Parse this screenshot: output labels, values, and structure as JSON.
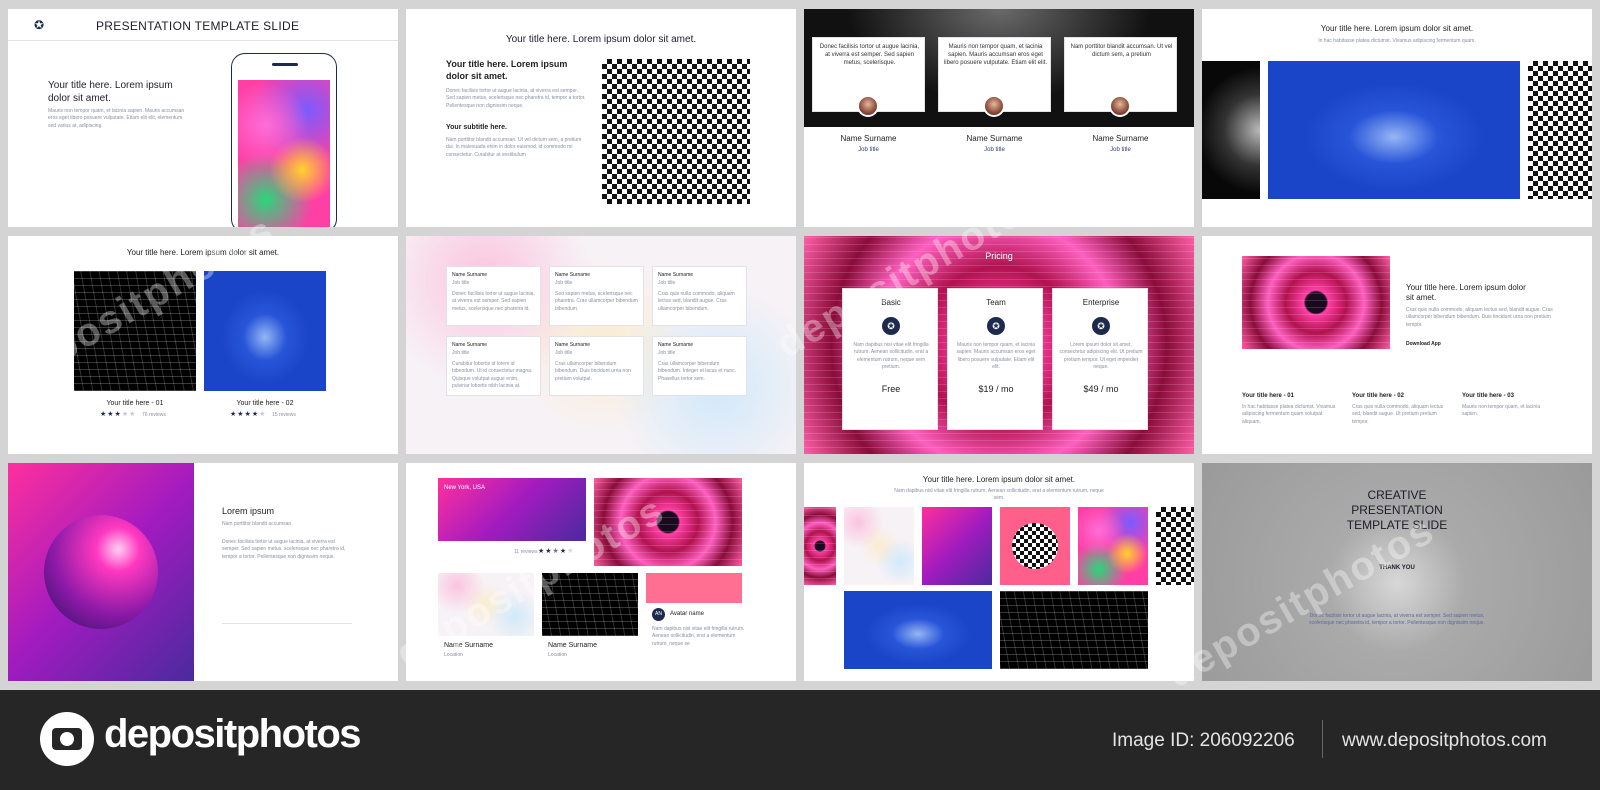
{
  "slides": {
    "s1": {
      "header": "PRESENTATION TEMPLATE SLIDE",
      "title": "Your title here. Lorem ipsum dolor sit amet.",
      "body": "Mauris non tempor quam, et lacinia sapien. Mauris accumsan eros eget libero posuere vulputate. Etiam elit elit, elementum sed varius at, adipiscing."
    },
    "s2": {
      "top_title": "Your title here. Lorem ipsum dolor sit amet.",
      "title": "Your title here. Lorem ipsum dolor sit amet.",
      "body": "Donec facilisis tortor ut augue lacinia, at viverra est semper. Sed sapien metus, scelerisque nec pharetra id, tempor a tortor. Pellentesque non dignissim neque.",
      "subtitle": "Your subtitle here.",
      "body2": "Nam porttitor blandit accumsan. Ut vel dictum sem, a pretium dui. In malesuada enim in dolor euismod, id commodo mi consectetur. Curabitur at vestibulum"
    },
    "s3": {
      "cards": [
        {
          "text": "Donec facilisis tortor ut augue lacinia, at viverra est semper. Sed sapien metus, scelerisque.",
          "name": "Name Surname",
          "job": "Job title"
        },
        {
          "text": "Mauris non tempor quam, et lacinia sapien. Mauris accumsan eros eget libero posuere vulputate. Etiam elit elit.",
          "name": "Name Surname",
          "job": "Job title"
        },
        {
          "text": "Nam porttitor blandit accumsan. Ut vel dictum sem, a pretium",
          "name": "Name Surname",
          "job": "Job title"
        }
      ]
    },
    "s4": {
      "title": "Your title here. Lorem ipsum dolor sit amet.",
      "subtitle": "In hac habitasse platea dictumst. Vivamus adipiscing fermentum quam."
    },
    "s5": {
      "title": "Your title here. Lorem ipsum dolor sit amet.",
      "item1": "Your title here - 01",
      "item1_reviews": "76 reviews",
      "item2": "Your title here - 02",
      "item2_reviews": "15 reviews"
    },
    "s6": {
      "cards": [
        {
          "name": "Name Surname",
          "job": "Job title",
          "text": "Donec facilisis tortor ut augue lacinia, at viverra est semper. Sed sapien metus, scelerisque nec pharetra id."
        },
        {
          "name": "Name Surname",
          "job": "Job title",
          "text": "Sed sapien metus, scelerisque nec pharetra. Cras ullamcorper bibendum bibendum."
        },
        {
          "name": "Name Surname",
          "job": "Job title",
          "text": "Cras quis nulla commodo, aliquam lectus sed, blandit augue. Cras ullamcorper bibendum."
        },
        {
          "name": "Name Surname",
          "job": "Job title",
          "text": "Curabitur lobortis id lorem id bibendum. Ut id consectetur magna. Quisque volutpat augue enim, pulvinar lobortis nibh lacinia at."
        },
        {
          "name": "Name Surname",
          "job": "Job title",
          "text": "Cras ullamcorper bibendum bibendum. Duis tincidunt urna non pretium volutpat."
        },
        {
          "name": "Name Surname",
          "job": "Job title",
          "text": "Cras ullamcorper bibendum bibendum. Integer et lacus et nunc. Phasellus tortor sem."
        }
      ]
    },
    "s7": {
      "title": "Pricing",
      "plans": [
        {
          "name": "Basic",
          "text": "Nam dapibus nisl vitae elit fringilla rutrum. Aenean sollicitudin, erat a elementum rutrum, neque sem pretium.",
          "price": "Free"
        },
        {
          "name": "Team",
          "text": "Mauris non tempor quam, et lacinia sapien. Mauris accumsan eros eget libero posuere vulputate. Etiam elit elit.",
          "price": "$19 / mo"
        },
        {
          "name": "Enterprise",
          "text": "Lorem ipsum dolor sit amet, consectetur adipiscing elit. Ut pretium pretium tempor. Ut eget imperdiet neque.",
          "price": "$49 / mo"
        }
      ]
    },
    "s8": {
      "title": "Your title here. Lorem ipsum dolor sit amet.",
      "body": "Cras quis nulla commodo, aliquam lectus sed, blandit augue. Cras ullamcorper bibendum bibendum. Duis tincidunt urna non pretium tempor.",
      "button": "Download App",
      "items": [
        {
          "title": "Your title here - 01",
          "text": "In hac habitasse platea dictumst. Vivamus adipiscing fermentum quam volutpat aliquam."
        },
        {
          "title": "Your title here - 02",
          "text": "Cras quis nulla commodo, aliquam lectus sed, blandit augue. Ut pretium pretium tempor."
        },
        {
          "title": "Your title here - 03",
          "text": "Mauris non tempor quam, et lacinia sapien."
        }
      ]
    },
    "s9": {
      "title": "Lorem ipsum",
      "subtitle": "Nam porttitor blandit accumsan.",
      "body": "Donec facilisis tortor ut augue lacinia, at viverra est semper. Sed sapien metus, scelerisque nec pharetra id, tempor a tortor. Pellentesque non dignissim neque."
    },
    "s10": {
      "card_title": "New York, USA",
      "reviews": "11 reviews",
      "name1": "Name Surname",
      "loc1": "Location",
      "name2": "Name Surname",
      "loc2": "Location",
      "avatar_initials": "AN",
      "avatar_name": "Avatar name",
      "avatar_text": "Nam dapibus nisl vitae elit fringilla rutrum. Aenean sollicitudin, erat a elementum rutrum, neque se"
    },
    "s11": {
      "title": "Your title here. Lorem ipsum dolor sit amet.",
      "subtitle": "Nam dapibus nisl vitae elit fringilla rutrum. Aenean sollicitudin, erat a elementum rutrum, neque sem."
    },
    "s12": {
      "title1": "CREATIVE",
      "title2": "PRESENTATION",
      "title3": "TEMPLATE SLIDE",
      "thanks": "THANK YOU",
      "body": "Donec facilisis tortor ut augue lacinia, at viverra est semper. Sed sapien metus, scelerisque nec pharetra id, tempor a tortor. Pellentesque non dignissim neque."
    }
  },
  "footer": {
    "brand": "depositphotos",
    "image_id": "Image ID: 206092206",
    "site": "www.depositphotos.com"
  },
  "watermark": "depositphotos",
  "colors": {
    "footer_bg": "#262626",
    "accent_blue": "#1b45c9",
    "accent_pink": "#ff3fa5",
    "navy": "#1c2a4e"
  }
}
